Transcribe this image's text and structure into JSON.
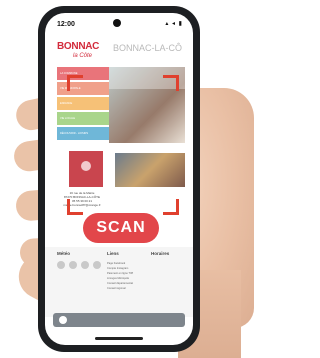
{
  "status_bar": {
    "time": "12:00",
    "icons": "▴ ◂ ▮"
  },
  "header": {
    "logo_word": "BONNAC",
    "logo_sub": "la Côte",
    "title": "BONNAC-LA-CÔ"
  },
  "menu": {
    "items": [
      {
        "label": "la commune",
        "color": "#e9747a"
      },
      {
        "label": "vie municipale",
        "color": "#f0a08a"
      },
      {
        "label": "enfance",
        "color": "#f6c177"
      },
      {
        "label": "vie locale",
        "color": "#a9d58b"
      },
      {
        "label": "découvrir - loisirs",
        "color": "#6fb7d8"
      }
    ]
  },
  "address": {
    "lines": [
      "16 rue de la Mairie",
      "87270 BONNAC-LA-CÔTE",
      "05 55 39 00 21",
      "mairie.bonnac87@orange.fr"
    ]
  },
  "scan_button": {
    "label": "SCAN",
    "color": "#e2464a"
  },
  "footer": {
    "col1": "Météo",
    "col2": "Liens",
    "col3": "Horaires",
    "links": [
      "Page Facebook",
      "Compte Instagram",
      "Paiement en ligne TIPI",
      "Limoges Métropole",
      "Conseil départemental",
      "Conseil régional"
    ]
  }
}
